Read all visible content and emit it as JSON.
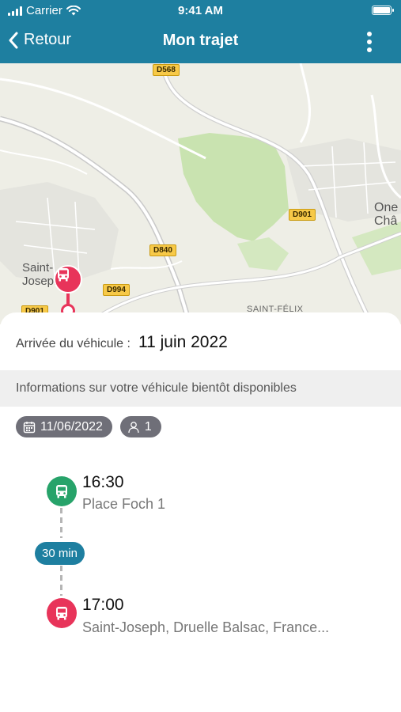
{
  "status_bar": {
    "carrier": "Carrier",
    "time": "9:41 AM"
  },
  "nav": {
    "back_label": "Retour",
    "title": "Mon trajet"
  },
  "map": {
    "road_labels": [
      "D568",
      "D901",
      "D840",
      "D994",
      "D901"
    ],
    "places": [
      "Saint-",
      "Joseph",
      "One",
      "Châ",
      "SAINT-FÉLIX"
    ]
  },
  "sheet": {
    "arrival_label": "Arrivée du véhicule :",
    "arrival_value": "11 juin 2022",
    "info_message": "Informations sur votre véhicule bientôt disponibles",
    "chips": {
      "date": "11/06/2022",
      "passengers": "1"
    }
  },
  "timeline": {
    "departure": {
      "time": "16:30",
      "place": "Place Foch 1"
    },
    "duration": "30 min",
    "arrival": {
      "time": "17:00",
      "place": "Saint-Joseph, Druelle Balsac, France..."
    }
  },
  "colors": {
    "primary": "#1e7fa0",
    "departure": "#27a36a",
    "arrival": "#e8345a",
    "chip": "#6f6f78"
  },
  "icons": [
    "chevron-left-icon",
    "more-vertical-icon",
    "calendar-icon",
    "person-icon",
    "bus-icon",
    "wifi-icon",
    "battery-icon"
  ]
}
